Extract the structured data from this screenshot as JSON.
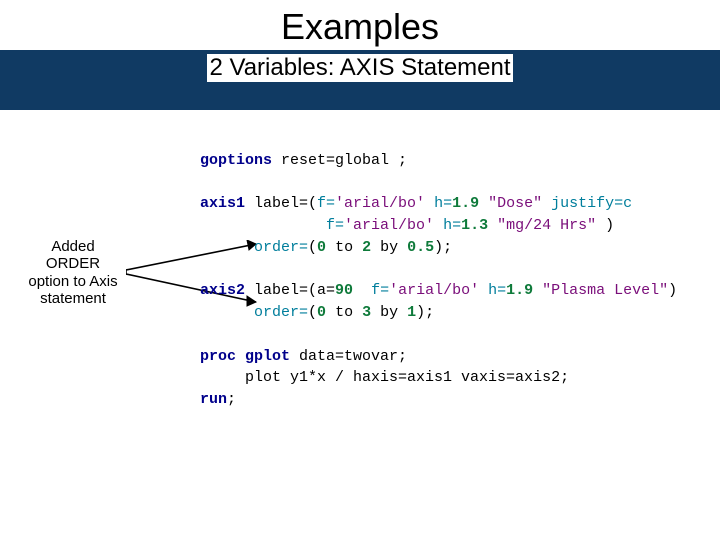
{
  "header": {
    "title": "Examples",
    "subtitle": "2 Variables: AXIS Statement"
  },
  "annotation": {
    "line1": "Added",
    "line2": "ORDER",
    "line3": "option to Axis",
    "line4": "statement"
  },
  "code": {
    "l1_kw": "goptions",
    "l1_rest": " reset=global ;",
    "l3_kw": "axis1",
    "l3_a": " label=(",
    "l3_f": "f=",
    "l3_fval": "'arial/bo'",
    "l3_h": " h=",
    "l3_hval": "1.9",
    "l3_s1": " \"Dose\"",
    "l3_j": " justify=c",
    "l4_pad": "              ",
    "l4_f": "f=",
    "l4_fval": "'arial/bo'",
    "l4_h": " h=",
    "l4_hval": "1.3",
    "l4_s": " \"mg/24 Hrs\"",
    "l4_close": " )",
    "l5_pad": "      ",
    "l5_opt": "order=",
    "l5_p1": "(",
    "l5_n1": "0",
    "l5_to": " to ",
    "l5_n2": "2",
    "l5_by": " by ",
    "l5_n3": "0.5",
    "l5_p2": ");",
    "l7_kw": "axis2",
    "l7_a": " label=(a=",
    "l7_aval": "90",
    "l7_sp": "  ",
    "l7_f": "f=",
    "l7_fval": "'arial/bo'",
    "l7_h": " h=",
    "l7_hval": "1.9",
    "l7_s": " \"Plasma Level\"",
    "l7_close": ")",
    "l8_pad": "      ",
    "l8_opt": "order=",
    "l8_p1": "(",
    "l8_n1": "0",
    "l8_to": " to ",
    "l8_n2": "3",
    "l8_by": " by ",
    "l8_n3": "1",
    "l8_p2": ");",
    "l10_kw": "proc gplot",
    "l10_rest": " data=twovar;",
    "l11_pad": "     ",
    "l11": "plot y1*x / haxis=axis1 vaxis=axis2;",
    "l12_kw": "run",
    "l12_semi": ";"
  }
}
